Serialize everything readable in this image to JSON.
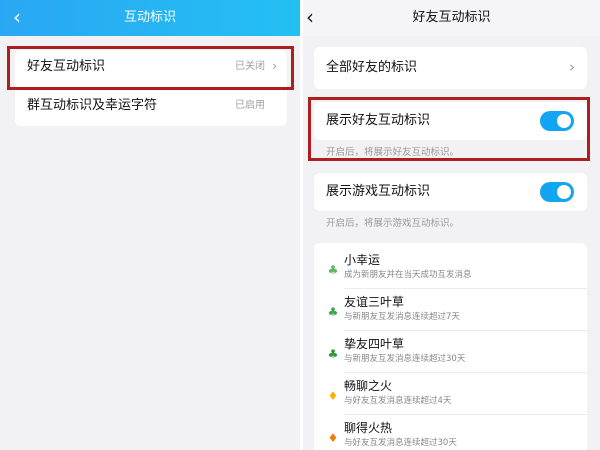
{
  "left": {
    "header": {
      "title": "互动标识",
      "back_icon": "‹"
    },
    "rows": [
      {
        "label": "好友互动标识",
        "status": "已关闭"
      },
      {
        "label": "群互动标识及幸运字符",
        "status": "已启用"
      }
    ]
  },
  "right": {
    "header": {
      "title": "好友互动标识",
      "back_icon": "‹"
    },
    "all_friends": {
      "label": "全部好友的标识"
    },
    "show_friend_badges": {
      "label": "展示好友互动标识",
      "hint": "开启后，将展示好友互动标识。",
      "enabled": true
    },
    "show_game_badges": {
      "label": "展示游戏互动标识",
      "hint": "开启后，将展示游戏互动标识。",
      "enabled": true
    },
    "badges": [
      {
        "name": "小幸运",
        "desc": "成为新朋友并在当天成功互发消息",
        "icon": "sprout-icon",
        "glyph": "♣",
        "color": "#5cb85c"
      },
      {
        "name": "友谊三叶草",
        "desc": "与新朋友互发消息连续超过7天",
        "icon": "three-leaf-clover-icon",
        "glyph": "♣",
        "color": "#3ea64a"
      },
      {
        "name": "挚友四叶草",
        "desc": "与新朋友互发消息连续超过30天",
        "icon": "four-leaf-clover-icon",
        "glyph": "♣",
        "color": "#2e9a3c"
      },
      {
        "name": "畅聊之火",
        "desc": "与好友互发消息连续超过4天",
        "icon": "flame-icon-yellow",
        "glyph": "♦",
        "color": "#f5b400"
      },
      {
        "name": "聊得火热",
        "desc": "与好友互发消息连续超过30天",
        "icon": "flame-icon-orange",
        "glyph": "♦",
        "color": "#f57c00"
      }
    ]
  },
  "chevron": "›",
  "colors": {
    "header_gradient_start": "#2aa7f4",
    "header_gradient_end": "#23c0f2",
    "toggle_on": "#12a6f2",
    "highlight": "#ad1e1e"
  }
}
